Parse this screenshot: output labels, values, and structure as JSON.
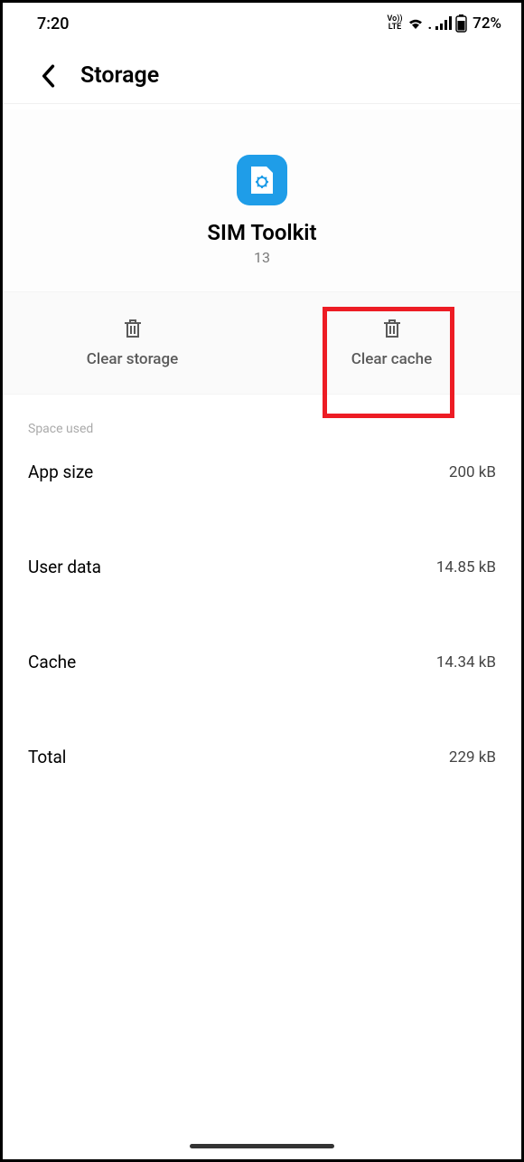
{
  "statusBar": {
    "time": "7:20",
    "batteryText": "72%"
  },
  "header": {
    "title": "Storage"
  },
  "app": {
    "name": "SIM Toolkit",
    "version": "13"
  },
  "actions": {
    "clearStorage": "Clear storage",
    "clearCache": "Clear cache"
  },
  "spaceUsed": {
    "heading": "Space used",
    "rows": [
      {
        "label": "App size",
        "value": "200 kB"
      },
      {
        "label": "User data",
        "value": "14.85 kB"
      },
      {
        "label": "Cache",
        "value": "14.34 kB"
      },
      {
        "label": "Total",
        "value": "229 kB"
      }
    ]
  }
}
